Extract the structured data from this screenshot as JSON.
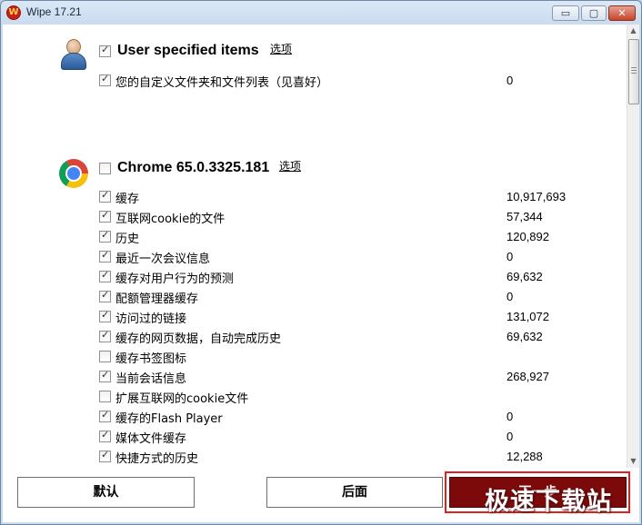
{
  "window": {
    "title": "Wipe 17.21",
    "min_glyph": "▭",
    "max_glyph": "▢",
    "close_glyph": "✕"
  },
  "sections": [
    {
      "title": "User specified items",
      "options_label": "选项",
      "checked": true,
      "icon": "user-icon",
      "items": [
        {
          "label": "您的自定义文件夹和文件列表（见喜好）",
          "value": "0",
          "checked": true
        }
      ]
    },
    {
      "title": "Chrome 65.0.3325.181",
      "options_label": "选项",
      "checked": false,
      "icon": "chrome-icon",
      "items": [
        {
          "label": "缓存",
          "value": "10,917,693",
          "checked": true
        },
        {
          "label": "互联网cookie的文件",
          "value": "57,344",
          "checked": true
        },
        {
          "label": "历史",
          "value": "120,892",
          "checked": true
        },
        {
          "label": "最近一次会议信息",
          "value": "0",
          "checked": true
        },
        {
          "label": "缓存对用户行为的预测",
          "value": "69,632",
          "checked": true
        },
        {
          "label": "配额管理器缓存",
          "value": "0",
          "checked": true
        },
        {
          "label": "访问过的链接",
          "value": "131,072",
          "checked": true
        },
        {
          "label": "缓存的网页数据，自动完成历史",
          "value": "69,632",
          "checked": true
        },
        {
          "label": "缓存书签图标",
          "value": "",
          "checked": false
        },
        {
          "label": "当前会话信息",
          "value": "268,927",
          "checked": true
        },
        {
          "label": "扩展互联网的cookie文件",
          "value": "",
          "checked": false
        },
        {
          "label": "缓存的Flash Player",
          "value": "0",
          "checked": true
        },
        {
          "label": "媒体文件缓存",
          "value": "0",
          "checked": true
        },
        {
          "label": "快捷方式的历史",
          "value": "12,288",
          "checked": true
        }
      ]
    }
  ],
  "buttons": {
    "default_label": "默认",
    "back_label": "后面",
    "next_label": "下一步"
  },
  "watermark": "极速下载站",
  "colors": {
    "accent": "#7c0a0a",
    "highlight_border": "#e0201c"
  }
}
